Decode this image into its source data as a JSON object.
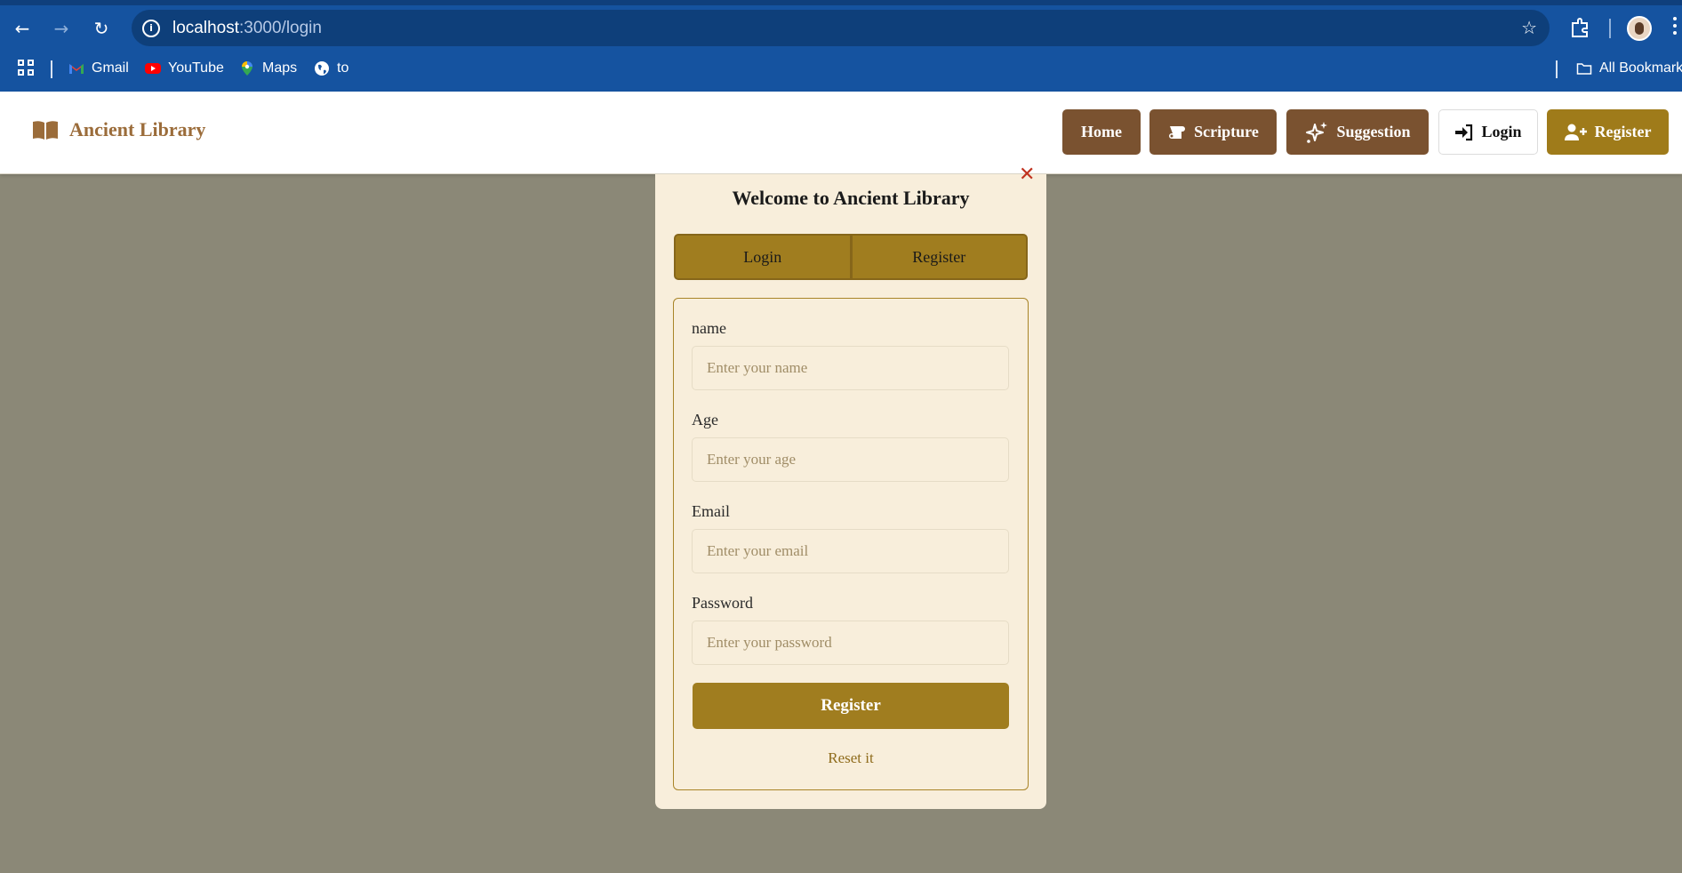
{
  "browser": {
    "url_host": "localhost",
    "url_path": ":3000/login",
    "bookmarks": [
      {
        "label": "Gmail",
        "icon": "gmail-icon"
      },
      {
        "label": "YouTube",
        "icon": "youtube-icon"
      },
      {
        "label": "Maps",
        "icon": "maps-icon"
      },
      {
        "label": "to",
        "icon": "globe-icon"
      }
    ],
    "all_bookmarks": "All Bookmarks"
  },
  "navbar": {
    "brand": "Ancient Library",
    "links": {
      "home": "Home",
      "scripture": "Scripture",
      "suggestion": "Suggestion",
      "login": "Login",
      "register": "Register"
    }
  },
  "modal": {
    "close": "✕",
    "title": "Welcome to Ancient Library",
    "tabs": {
      "login": "Login",
      "register": "Register"
    },
    "fields": {
      "name": {
        "label": "name",
        "placeholder": "Enter your name"
      },
      "age": {
        "label": "Age",
        "placeholder": "Enter your age"
      },
      "email": {
        "label": "Email",
        "placeholder": "Enter your email"
      },
      "password": {
        "label": "Password",
        "placeholder": "Enter your password"
      }
    },
    "submit": "Register",
    "reset": "Reset it"
  },
  "colors": {
    "chrome_blue": "#1553a0",
    "overlay": "#8b8877",
    "brand_brown": "#9b6c3a",
    "nav_brown": "#7a5230",
    "gold": "#a07d1f",
    "modal_bg": "#f8eedb"
  }
}
